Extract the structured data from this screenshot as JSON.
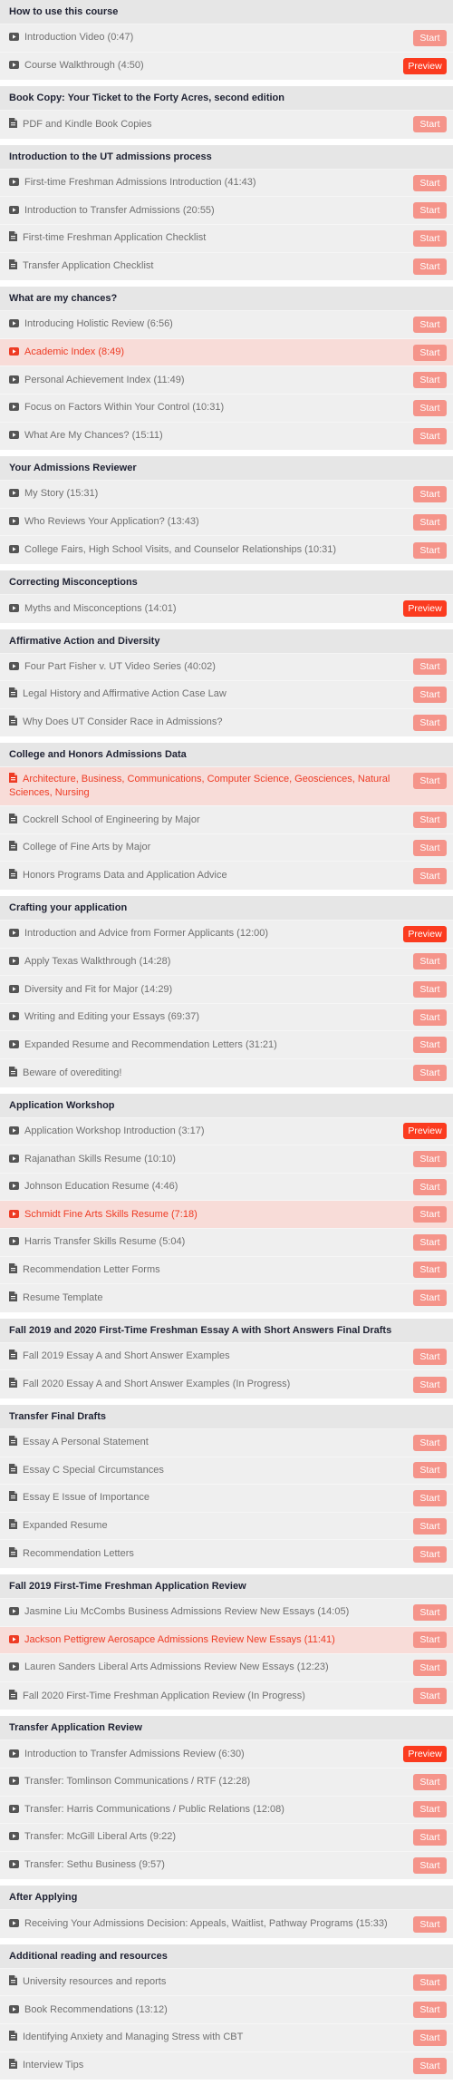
{
  "colors": {
    "accent": "#fb3b1f",
    "start_button": "#f5948a",
    "active_row_bg": "#f8dcd8",
    "active_text": "#ee3b24",
    "header_bg": "#e6e6e6",
    "row_bg": "#efefef"
  },
  "buttons": {
    "start": "Start",
    "preview": "Preview"
  },
  "sections": [
    {
      "title": "How to use this course",
      "items": [
        {
          "icon": "video-icon",
          "title": "Introduction Video (0:47)",
          "button": "start"
        },
        {
          "icon": "video-icon",
          "title": "Course Walkthrough (4:50)",
          "button": "preview"
        }
      ]
    },
    {
      "title": "Book Copy: Your Ticket to the Forty Acres, second edition",
      "items": [
        {
          "icon": "document-icon",
          "title": "PDF and Kindle Book Copies",
          "button": "start"
        }
      ]
    },
    {
      "title": "Introduction to the UT admissions process",
      "items": [
        {
          "icon": "video-icon",
          "title": "First-time Freshman Admissions Introduction (41:43)",
          "button": "start"
        },
        {
          "icon": "video-icon",
          "title": "Introduction to Transfer Admissions (20:55)",
          "button": "start"
        },
        {
          "icon": "document-icon",
          "title": "First-time Freshman Application Checklist",
          "button": "start"
        },
        {
          "icon": "document-icon",
          "title": "Transfer Application Checklist",
          "button": "start"
        }
      ]
    },
    {
      "title": "What are my chances?",
      "items": [
        {
          "icon": "video-icon",
          "title": "Introducing Holistic Review (6:56)",
          "button": "start"
        },
        {
          "icon": "video-icon",
          "title": "Academic Index (8:49)",
          "button": "start",
          "active": true
        },
        {
          "icon": "video-icon",
          "title": "Personal Achievement Index (11:49)",
          "button": "start"
        },
        {
          "icon": "video-icon",
          "title": "Focus on Factors Within Your Control (10:31)",
          "button": "start"
        },
        {
          "icon": "video-icon",
          "title": "What Are My Chances? (15:11)",
          "button": "start"
        }
      ]
    },
    {
      "title": "Your Admissions Reviewer",
      "items": [
        {
          "icon": "video-icon",
          "title": "My Story (15:31)",
          "button": "start"
        },
        {
          "icon": "video-icon",
          "title": "Who Reviews Your Application? (13:43)",
          "button": "start"
        },
        {
          "icon": "video-icon",
          "title": "College Fairs, High School Visits, and Counselor Relationships (10:31)",
          "button": "start"
        }
      ]
    },
    {
      "title": "Correcting Misconceptions",
      "items": [
        {
          "icon": "video-icon",
          "title": "Myths and Misconceptions (14:01)",
          "button": "preview"
        }
      ]
    },
    {
      "title": "Affirmative Action and Diversity",
      "items": [
        {
          "icon": "video-icon",
          "title": "Four Part Fisher v. UT Video Series (40:02)",
          "button": "start"
        },
        {
          "icon": "document-icon",
          "title": "Legal History and Affirmative Action Case Law",
          "button": "start"
        },
        {
          "icon": "document-icon",
          "title": "Why Does UT Consider Race in Admissions?",
          "button": "start"
        }
      ]
    },
    {
      "title": "College and Honors Admissions Data",
      "items": [
        {
          "icon": "document-icon",
          "title": "Architecture, Business, Communications, Computer Science, Geosciences, Natural Sciences, Nursing",
          "button": "start",
          "active": true,
          "tall": true
        },
        {
          "icon": "document-icon",
          "title": "Cockrell School of Engineering by Major",
          "button": "start"
        },
        {
          "icon": "document-icon",
          "title": "College of Fine Arts by Major",
          "button": "start"
        },
        {
          "icon": "document-icon",
          "title": "Honors Programs Data and Application Advice",
          "button": "start"
        }
      ]
    },
    {
      "title": "Crafting your application",
      "items": [
        {
          "icon": "video-icon",
          "title": "Introduction and Advice from Former Applicants (12:00)",
          "button": "preview"
        },
        {
          "icon": "video-icon",
          "title": "Apply Texas Walkthrough (14:28)",
          "button": "start"
        },
        {
          "icon": "video-icon",
          "title": "Diversity and Fit for Major (14:29)",
          "button": "start"
        },
        {
          "icon": "video-icon",
          "title": "Writing and Editing your Essays (69:37)",
          "button": "start"
        },
        {
          "icon": "video-icon",
          "title": "Expanded Resume and Recommendation Letters (31:21)",
          "button": "start"
        },
        {
          "icon": "document-icon",
          "title": "Beware of overediting!",
          "button": "start"
        }
      ]
    },
    {
      "title": "Application Workshop",
      "items": [
        {
          "icon": "video-icon",
          "title": "Application Workshop Introduction (3:17)",
          "button": "preview"
        },
        {
          "icon": "video-icon",
          "title": "Rajanathan Skills Resume (10:10)",
          "button": "start"
        },
        {
          "icon": "video-icon",
          "title": "Johnson Education Resume (4:46)",
          "button": "start"
        },
        {
          "icon": "video-icon",
          "title": "Schmidt Fine Arts Skills Resume (7:18)",
          "button": "start",
          "active": true
        },
        {
          "icon": "video-icon",
          "title": "Harris Transfer Skills Resume (5:04)",
          "button": "start"
        },
        {
          "icon": "document-icon",
          "title": "Recommendation Letter Forms",
          "button": "start"
        },
        {
          "icon": "document-icon",
          "title": "Resume Template",
          "button": "start"
        }
      ]
    },
    {
      "title": "Fall 2019 and 2020 First-Time Freshman Essay A with Short Answers Final Drafts",
      "items": [
        {
          "icon": "document-icon",
          "title": "Fall 2019 Essay A and Short Answer Examples",
          "button": "start"
        },
        {
          "icon": "document-icon",
          "title": "Fall 2020 Essay A and Short Answer Examples (In Progress)",
          "button": "start"
        }
      ]
    },
    {
      "title": "Transfer Final Drafts",
      "items": [
        {
          "icon": "document-icon",
          "title": "Essay A Personal Statement",
          "button": "start"
        },
        {
          "icon": "document-icon",
          "title": "Essay C Special Circumstances",
          "button": "start"
        },
        {
          "icon": "document-icon",
          "title": "Essay E Issue of Importance",
          "button": "start"
        },
        {
          "icon": "document-icon",
          "title": "Expanded Resume",
          "button": "start"
        },
        {
          "icon": "document-icon",
          "title": "Recommendation Letters",
          "button": "start"
        }
      ]
    },
    {
      "title": "Fall 2019 First-Time Freshman Application Review",
      "items": [
        {
          "icon": "video-icon",
          "title": "Jasmine Liu McCombs Business Admissions Review New Essays (14:05)",
          "button": "start"
        },
        {
          "icon": "video-icon",
          "title": "Jackson Pettigrew Aerosapce Admissions Review New Essays (11:41)",
          "button": "start",
          "active": true
        },
        {
          "icon": "video-icon",
          "title": "Lauren Sanders Liberal Arts Admissions Review New Essays (12:23)",
          "button": "start"
        },
        {
          "icon": "document-icon",
          "title": "Fall 2020 First-Time Freshman Application Review (In Progress)",
          "button": "start"
        }
      ]
    },
    {
      "title": "Transfer Application Review",
      "items": [
        {
          "icon": "video-icon",
          "title": "Introduction to Transfer Admissions Review (6:30)",
          "button": "preview"
        },
        {
          "icon": "video-icon",
          "title": "Transfer: Tomlinson Communications / RTF (12:28)",
          "button": "start"
        },
        {
          "icon": "video-icon",
          "title": "Transfer: Harris Communications / Public Relations (12:08)",
          "button": "start"
        },
        {
          "icon": "video-icon",
          "title": "Transfer: McGill Liberal Arts (9:22)",
          "button": "start"
        },
        {
          "icon": "video-icon",
          "title": "Transfer: Sethu Business (9:57)",
          "button": "start"
        }
      ]
    },
    {
      "title": "After Applying",
      "items": [
        {
          "icon": "video-icon",
          "title": "Receiving Your Admissions Decision: Appeals, Waitlist, Pathway Programs (15:33)",
          "button": "start"
        }
      ]
    },
    {
      "title": "Additional reading and resources",
      "items": [
        {
          "icon": "document-icon",
          "title": "University resources and reports",
          "button": "start"
        },
        {
          "icon": "video-icon",
          "title": "Book Recommendations (13:12)",
          "button": "start"
        },
        {
          "icon": "document-icon",
          "title": "Identifying Anxiety and Managing Stress with CBT",
          "button": "start"
        },
        {
          "icon": "document-icon",
          "title": "Interview Tips",
          "button": "start"
        }
      ]
    }
  ]
}
